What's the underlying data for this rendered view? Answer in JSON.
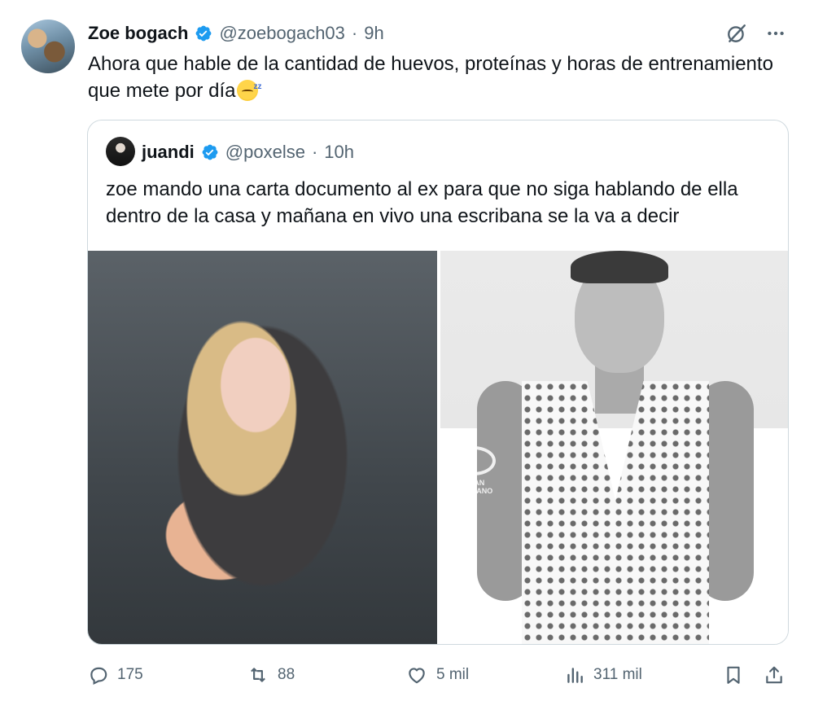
{
  "author": {
    "name": "Zoe bogach",
    "handle": "@zoebogach03",
    "separator": "·",
    "time": "9h"
  },
  "tweet": {
    "text": "Ahora que hable de la cantidad de huevos, proteínas y horas de entrenamiento que mete por día",
    "emoji": "sleeping-face"
  },
  "quoted": {
    "name": "juandi",
    "handle": "@poxelse",
    "separator": "·",
    "time": "10h",
    "text": "zoe mando una carta documento al ex para que no siga hablando de ella dentro de la casa y mañana en vivo una escribana se la va a decir",
    "media": [
      {
        "description": "blonde-woman-sequin-hood-photo"
      },
      {
        "description": "man-white-mesh-vest-photo",
        "watermarks": [
          "GRAN HERMANO",
          "telefe"
        ]
      }
    ]
  },
  "actions": {
    "replies": "175",
    "reposts": "88",
    "likes": "5 mil",
    "views": "311 mil"
  },
  "colors": {
    "verified": "#1d9bf0",
    "text": "#0f1419",
    "muted": "#536471",
    "border": "#cfd9de"
  }
}
